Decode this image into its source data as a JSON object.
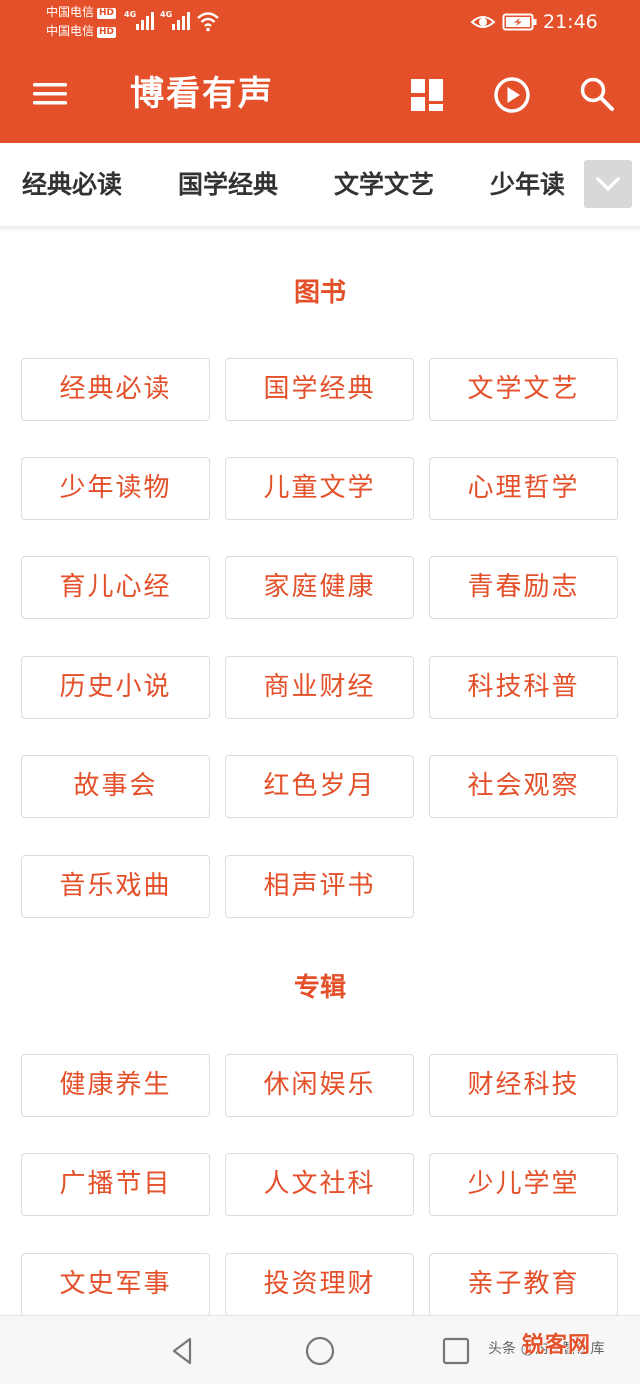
{
  "status_bar": {
    "carrier_1": "中国电信",
    "carrier_2": "中国电信",
    "hd": "HD",
    "network_1": "4G",
    "network_2": "4G",
    "time": "21:46"
  },
  "toolbar": {
    "title": "博看有声",
    "icons": [
      "menu-icon",
      "grid-icon",
      "play-circle-icon",
      "search-icon"
    ]
  },
  "tabs": [
    "经典必读",
    "国学经典",
    "文学文艺",
    "少年读"
  ],
  "sections": {
    "books": {
      "title": "图书",
      "items": [
        "经典必读",
        "国学经典",
        "文学文艺",
        "少年读物",
        "儿童文学",
        "心理哲学",
        "育儿心经",
        "家庭健康",
        "青春励志",
        "历史小说",
        "商业财经",
        "科技科普",
        "故事会",
        "红色岁月",
        "社会观察",
        "音乐戏曲",
        "相声评书"
      ]
    },
    "albums": {
      "title": "专辑",
      "items": [
        "健康养生",
        "休闲娱乐",
        "财经科技",
        "广播节目",
        "人文社科",
        "少儿学堂",
        "文史军事",
        "投资理财",
        "亲子教育"
      ]
    }
  },
  "watermark": {
    "text": "头条 @内蒙智慧库",
    "logo": "锐客网"
  },
  "colors": {
    "accent": "#E4502A",
    "chip_border": "#dcdcdc",
    "tab_text": "#333333"
  }
}
